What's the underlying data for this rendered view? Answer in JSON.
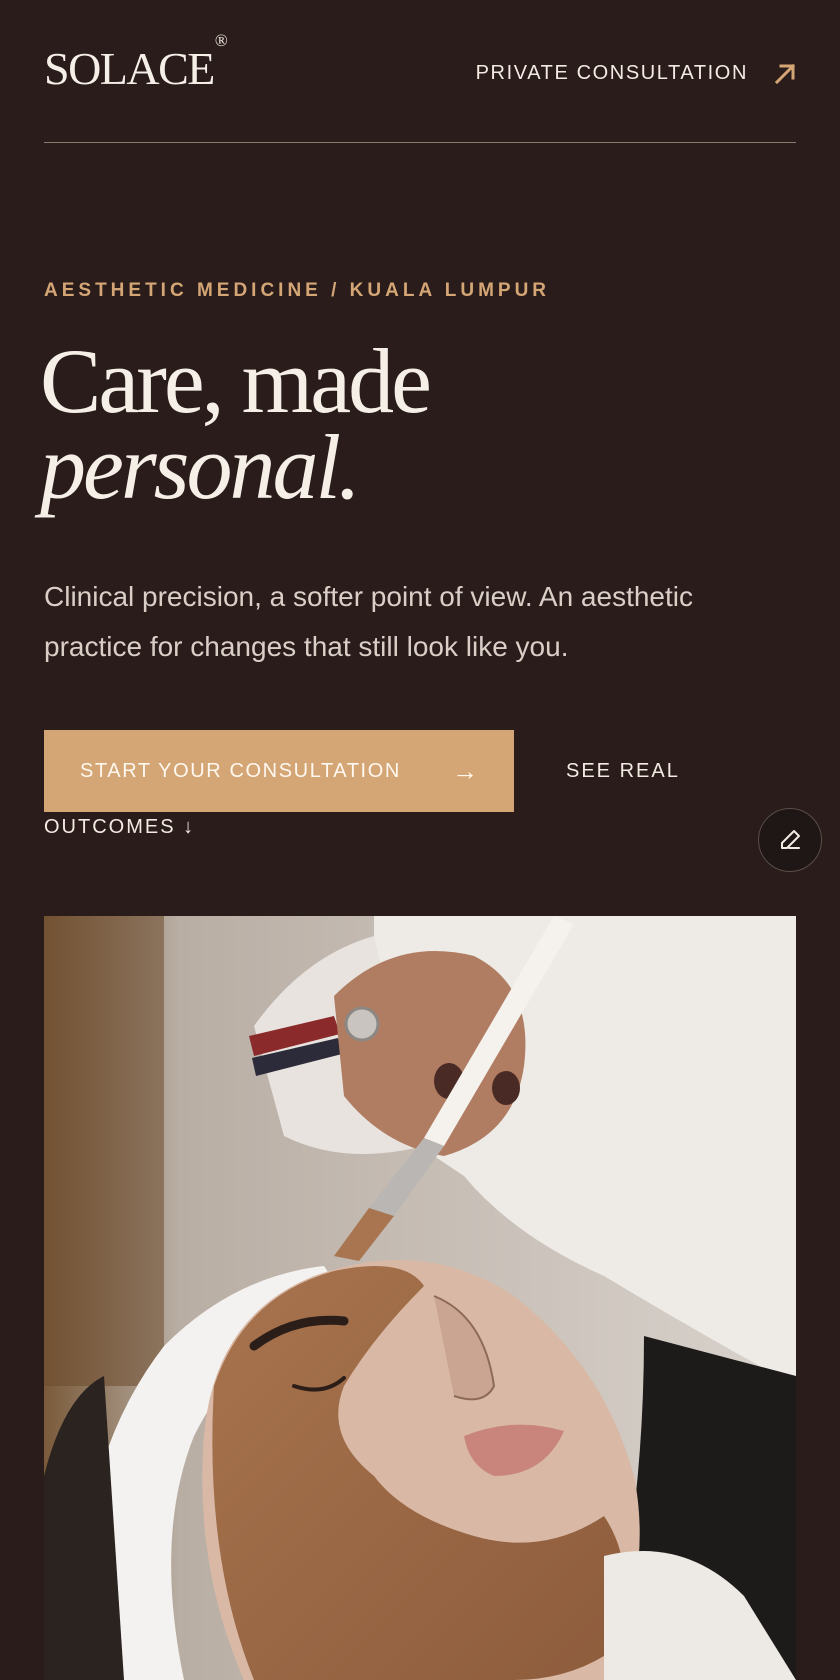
{
  "header": {
    "logo": "SOLACE",
    "logo_mark": "®",
    "nav_link": "PRIVATE CONSULTATION",
    "nav_icon": "arrow-up-right-icon"
  },
  "hero": {
    "eyebrow": "AESTHETIC MEDICINE / KUALA LUMPUR",
    "headline_line1": "Care, made",
    "headline_line2": "personal.",
    "lede": "Clinical precision, a softer point of view. An aesthetic practice for changes that still look like you.",
    "cta_primary": "START YOUR CONSULTATION",
    "cta_primary_icon": "→",
    "cta_secondary_part1": "SEE REAL",
    "cta_secondary_part2": "OUTCOMES ↓",
    "edit_icon": "pencil-icon"
  },
  "colors": {
    "background": "#2a1c1a",
    "accent": "#d5a675",
    "text": "#f3ebe3"
  }
}
